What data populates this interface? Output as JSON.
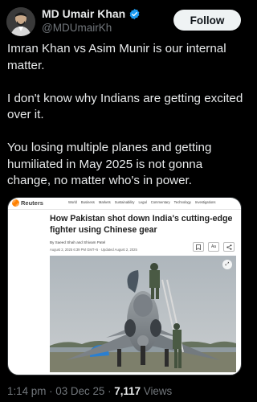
{
  "author": {
    "display_name": "MD Umair Khan",
    "handle": "@MDUmairKh",
    "verified": true,
    "verified_color": "#1d9bf0"
  },
  "follow_button": {
    "label": "Follow"
  },
  "tweet": {
    "paragraphs": [
      "Imran Khan vs Asim Munir is our internal matter.",
      "I don't know why Indians are getting excited over it.",
      "You losing multiple planes and getting humiliated in May 2025 is not gonna change, no matter who's in power."
    ]
  },
  "card": {
    "site_logo": "Reuters",
    "nav_items": [
      "World",
      "Business",
      "Markets",
      "Sustainability",
      "Legal",
      "Commentary",
      "Technology",
      "Investigations"
    ],
    "headline": "How Pakistan shot down India's cutting-edge fighter using Chinese gear",
    "byline": "By Saeed Shah and Shivam Patel",
    "dateline": "August 2, 2025 6:39 PM GMT+5 · Updated August 2, 2025",
    "action_aa": "Aa",
    "bookmark_icon": "bookmark-icon",
    "share_icon": "share-icon",
    "expand_icon": "expand-icon"
  },
  "footer": {
    "time": "1:14 pm",
    "separator": " · ",
    "date": "03 Dec 25",
    "views_count": "7,117",
    "views_label": " Views"
  }
}
